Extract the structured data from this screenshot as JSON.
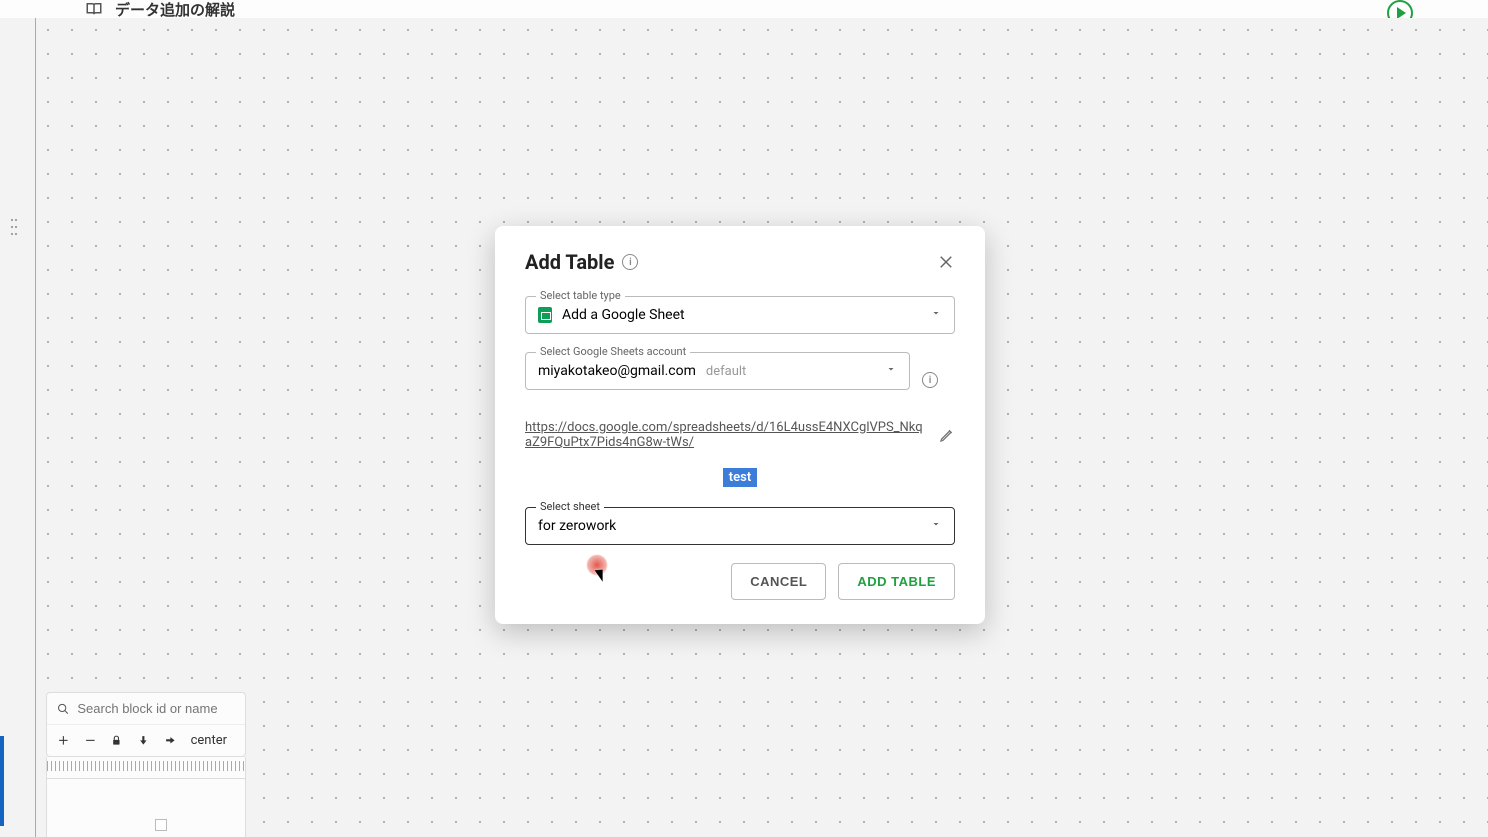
{
  "header": {
    "title": "データ追加の解説"
  },
  "toolbox": {
    "search_placeholder": "Search block id or name",
    "center_label": "center"
  },
  "modal": {
    "title": "Add Table",
    "table_type_label": "Select table type",
    "table_type_value": "Add a Google Sheet",
    "account_label": "Select Google Sheets account",
    "account_value": "miyakotakeo@gmail.com",
    "account_default": "default",
    "url": "https://docs.google.com/spreadsheets/d/16L4ussE4NXCglVPS_NkqaZ9FQuPtx7Pids4nG8w-tWs/",
    "test_label": "test",
    "sheet_label": "Select sheet",
    "sheet_value": "for zerowork",
    "cancel_label": "CANCEL",
    "add_label": "ADD TABLE"
  }
}
